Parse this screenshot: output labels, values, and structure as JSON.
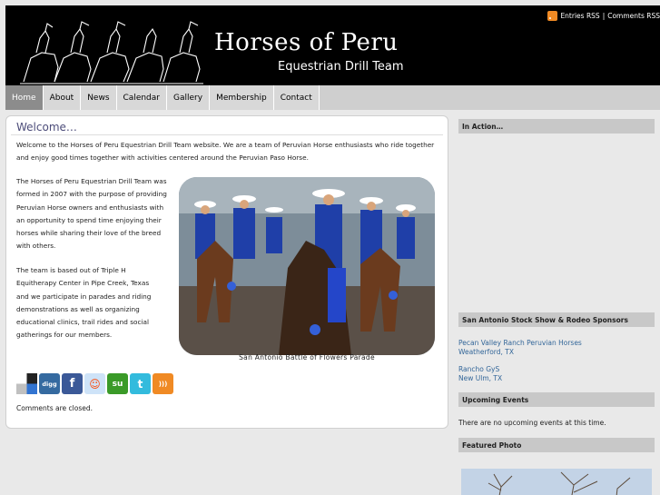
{
  "header": {
    "title": "Horses of Peru",
    "tagline": "Equestrian Drill Team",
    "entries_rss": "Entries RSS",
    "separator": "|",
    "comments_rss": "Comments RSS"
  },
  "nav": {
    "items": [
      {
        "label": "Home",
        "active": true
      },
      {
        "label": "About"
      },
      {
        "label": "News"
      },
      {
        "label": "Calendar"
      },
      {
        "label": "Gallery"
      },
      {
        "label": "Membership"
      },
      {
        "label": "Contact"
      }
    ]
  },
  "main": {
    "title": "Welcome…",
    "intro": "Welcome to the Horses of Peru Equestrian Drill Team website.  We are a team of Peruvian Horse enthusiasts who ride together and enjoy good times together with activities centered around the Peruvian Paso Horse.",
    "formed": "The Horses of Peru Equestrian Drill Team was formed in 2007 with the purpose of providing Peruvian Horse owners and enthusiasts with an opportunity to spend time enjoying their horses while sharing their love of the breed with others.",
    "based": "The team is based out of Triple H Equitherapy Center in Pipe Creek, Texas and we participate in parades and riding demonstrations as well as organizing educational clinics, trail rides and social gatherings for our members.",
    "photo_caption": "San Antonio Battle of Flowers Parade",
    "share_icons": [
      {
        "name": "delicious-icon",
        "glyph": "",
        "color": "#3274d1"
      },
      {
        "name": "digg-icon",
        "glyph": "digg",
        "color": "#356aa0"
      },
      {
        "name": "facebook-icon",
        "glyph": "f",
        "color": "#3b5998"
      },
      {
        "name": "reddit-icon",
        "glyph": "☺",
        "color": "#cee3f8"
      },
      {
        "name": "stumbleupon-icon",
        "glyph": "su",
        "color": "#3a9a28"
      },
      {
        "name": "twitter-icon",
        "glyph": "t",
        "color": "#33bbdd"
      },
      {
        "name": "rss-icon",
        "glyph": ")))",
        "color": "#f08a24"
      }
    ],
    "comments_closed": "Comments are closed."
  },
  "sidebar": {
    "in_action_title": "In Action…",
    "sponsors_title": "San Antonio Stock Show & Rodeo Sponsors",
    "sponsors": [
      {
        "name": "Pecan Valley Ranch Peruvian Horses",
        "location": "Weatherford, TX"
      },
      {
        "name": "Rancho GyS",
        "location": "New Ulm, TX"
      }
    ],
    "upcoming_title": "Upcoming Events",
    "upcoming_text": "There are no upcoming events at this time.",
    "featured_title": "Featured Photo"
  },
  "colors": {
    "header_bg": "#000000",
    "nav_active": "#8c8c8c",
    "link": "#336699",
    "rss": "#f08a24"
  }
}
